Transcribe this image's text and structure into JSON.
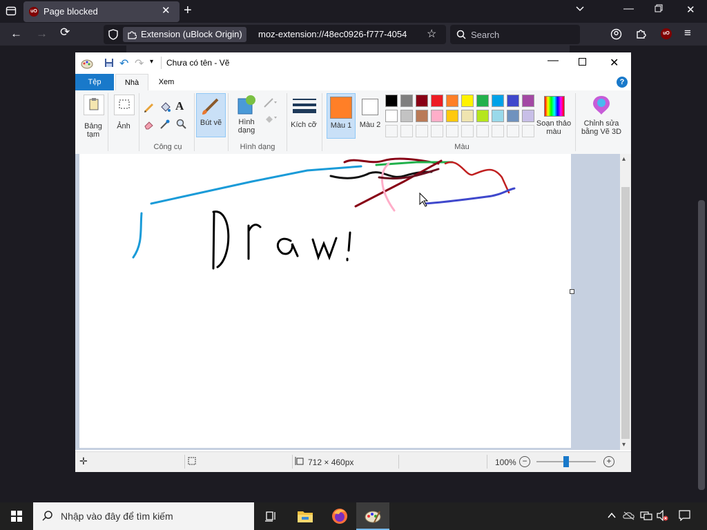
{
  "browser": {
    "tab_title": "Page blocked",
    "extension_label": "Extension (uBlock Origin)",
    "url": "moz-extension://48ec0926-f777-4054",
    "search_placeholder": "Search",
    "favicon_text": "uO"
  },
  "paint": {
    "window_title": "Chưa có tên - Vẽ",
    "tabs": [
      "Tệp",
      "Nhà",
      "Xem"
    ],
    "groups": {
      "clipboard_label": "Bảng tạm",
      "image_label": "Ảnh",
      "tools_label": "Công cụ",
      "brush_label": "Bút vẽ",
      "shapes_label": "Hình dạng",
      "size_label": "Kích cỡ",
      "color1_label": "Màu 1",
      "color2_label": "Màu 2",
      "colors_group_label": "Màu",
      "edit_colors_label": "Soạn thảo màu",
      "paint3d_label": "Chỉnh sửa bằng Vẽ 3D",
      "shapes_group_label": "Hình dạng"
    },
    "color1": "#ff7f27",
    "color2": "#ffffff",
    "palette_row1": [
      "#000000",
      "#7f7f7f",
      "#880015",
      "#ed1c24",
      "#ff7f27",
      "#fff200",
      "#22b14c",
      "#00a2e8",
      "#3f48cc",
      "#a349a4"
    ],
    "palette_row2": [
      "#ffffff",
      "#c3c3c3",
      "#b97a57",
      "#ffaec9",
      "#ffc90e",
      "#efe4b0",
      "#b5e61d",
      "#99d9ea",
      "#7092be",
      "#c8bfe7"
    ],
    "status": {
      "dimensions": "712 × 460px",
      "zoom": "100%"
    }
  },
  "taskbar": {
    "search_placeholder": "Nhập vào đây để tìm kiếm"
  }
}
